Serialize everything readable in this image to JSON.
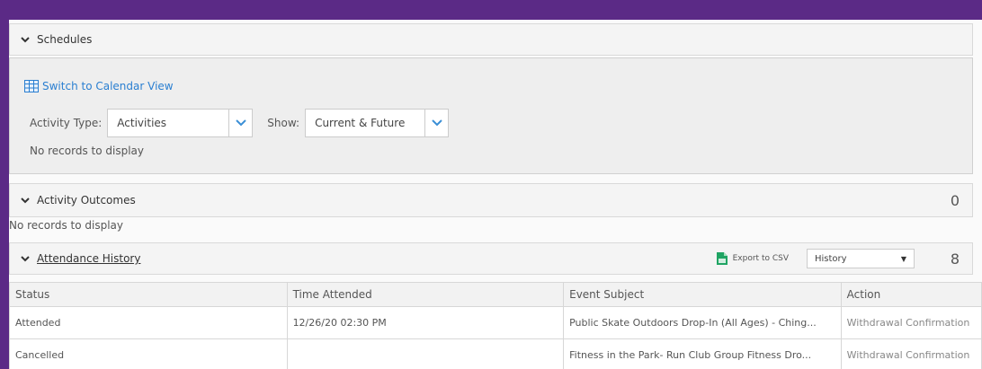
{
  "schedules": {
    "title": "Schedules",
    "calendar_link": "Switch to Calendar View",
    "activity_type_label": "Activity Type:",
    "activity_type_value": "Activities",
    "show_label": "Show:",
    "show_value": "Current & Future",
    "no_records": "No records to display"
  },
  "outcomes": {
    "title": "Activity Outcomes",
    "count": "0",
    "no_records": "No records to display"
  },
  "attendance": {
    "title": "Attendance History",
    "export_label": "Export to CSV",
    "filter_value": "History",
    "count": "8",
    "columns": [
      "Status",
      "Time Attended",
      "Event Subject",
      "Action"
    ],
    "rows": [
      {
        "status": "Attended",
        "time": "12/26/20 02:30 PM",
        "subject": "Public Skate Outdoors Drop-In (All Ages) - Ching...",
        "action": "Withdrawal Confirmation"
      },
      {
        "status": "Cancelled",
        "time": "",
        "subject": "Fitness in the Park- Run Club Group Fitness Dro...",
        "action": "Withdrawal Confirmation"
      }
    ]
  },
  "colors": {
    "accent": "#5b2a86",
    "link": "#2a7fd1",
    "excel": "#1fa463"
  }
}
